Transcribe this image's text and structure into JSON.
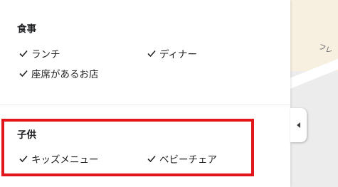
{
  "sections": [
    {
      "title": "食事",
      "items": [
        "ランチ",
        "ディナー",
        "座席があるお店"
      ]
    },
    {
      "title": "子供",
      "items": [
        "キッズメニュー",
        "ベビーチェア"
      ]
    }
  ],
  "map": {
    "label": "フレ"
  },
  "icons": {
    "check": "check-icon",
    "collapse": "collapse-arrow-icon"
  },
  "colors": {
    "highlight": "#e0161b"
  }
}
